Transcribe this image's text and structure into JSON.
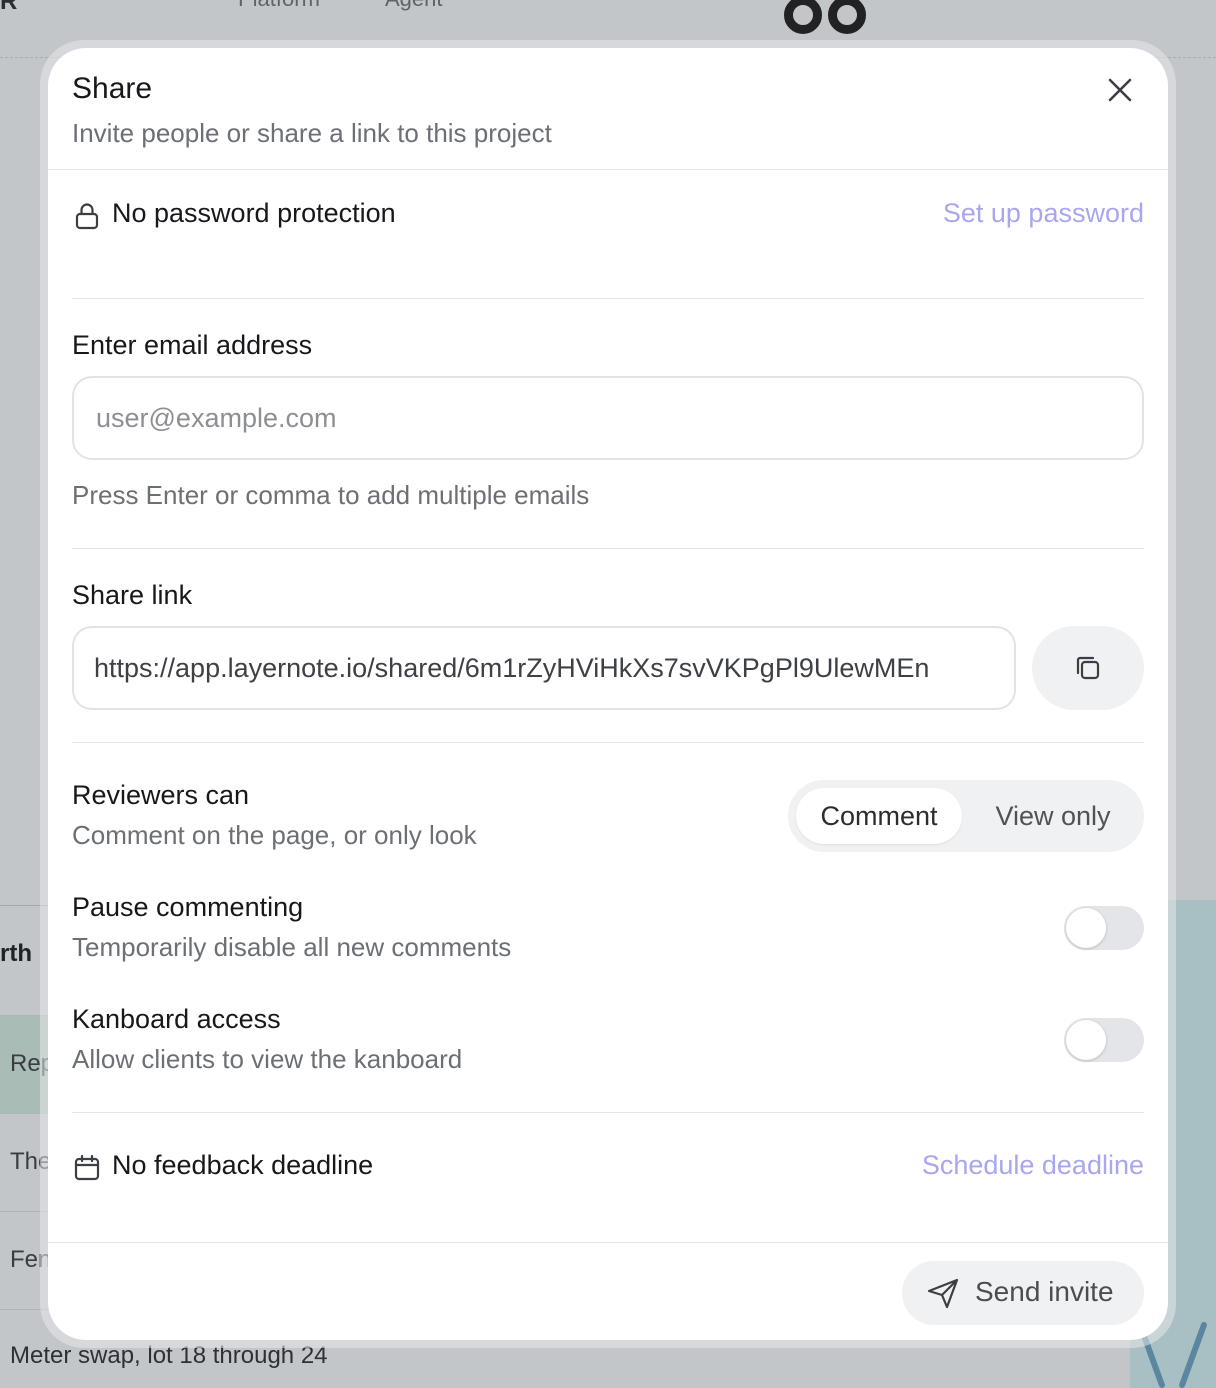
{
  "background": {
    "brand": "R",
    "nav": [
      "Platform",
      "Agent"
    ],
    "table_head": "rth",
    "rows": [
      "Rep",
      "The",
      "Fen"
    ],
    "footer_text": "Meter swap, lot 18 through 24"
  },
  "modal": {
    "title": "Share",
    "subtitle": "Invite people or share a link to this project",
    "close_icon": "close-icon"
  },
  "password": {
    "icon": "lock-icon",
    "label": "No password protection",
    "action": "Set up password"
  },
  "email": {
    "label": "Enter email address",
    "placeholder": "user@example.com",
    "value": "",
    "hint": "Press Enter or comma to add multiple emails"
  },
  "share_link": {
    "label": "Share link",
    "url": "https://app.layernote.io/shared/6m1rZyHViHkXs7svVKPgPl9UlewMEn",
    "copy_icon": "copy-icon"
  },
  "reviewers": {
    "title": "Reviewers can",
    "description": "Comment on the page, or only look",
    "options": [
      "Comment",
      "View only"
    ],
    "selected": "Comment"
  },
  "pause_commenting": {
    "title": "Pause commenting",
    "description": "Temporarily disable all new comments",
    "enabled": false
  },
  "kanboard": {
    "title": "Kanboard access",
    "description": "Allow clients to view the kanboard",
    "enabled": false
  },
  "deadline": {
    "icon": "calendar-icon",
    "label": "No feedback deadline",
    "action": "Schedule deadline"
  },
  "footer": {
    "send_label": "Send invite",
    "send_icon": "send-icon"
  },
  "colors": {
    "accent_link": "#a8a6ee",
    "text_primary": "#16181b",
    "text_muted": "#6b7076"
  }
}
